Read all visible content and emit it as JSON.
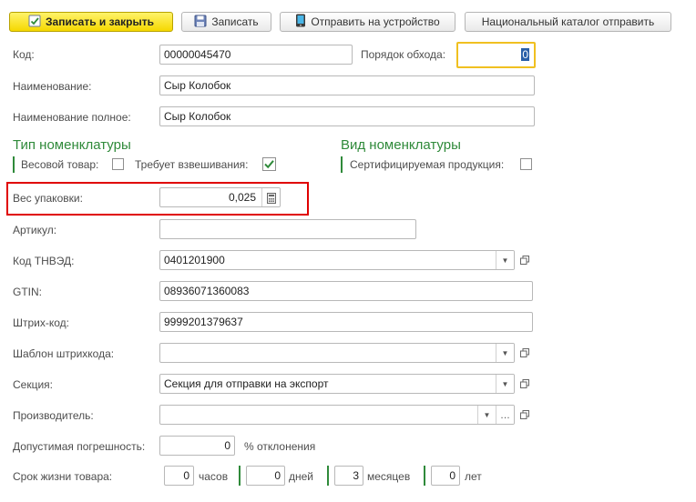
{
  "toolbar": {
    "save_close_label": "Записать и закрыть",
    "save_label": "Записать",
    "send_device_label": "Отправить на устройство",
    "national_catalog_label": "Национальный каталог отправить"
  },
  "form": {
    "code": {
      "label": "Код:",
      "value": "00000045470"
    },
    "order": {
      "label": "Порядок обхода:",
      "value": "0"
    },
    "name": {
      "label": "Наименование:",
      "value": "Сыр Колобок"
    },
    "full_name": {
      "label": "Наименование полное:",
      "value": "Сыр Колобок"
    },
    "type_section": {
      "title": "Тип номенклатуры",
      "weight_label": "Весовой товар:",
      "weight_checked": false,
      "weighing_label": "Требует взвешивания:",
      "weighing_checked": true
    },
    "kind_section": {
      "title": "Вид номенклатуры",
      "certified_label": "Сертифицируемая продукция:",
      "certified_checked": false
    },
    "pack_weight": {
      "label": "Вес упаковки:",
      "value": "0,025"
    },
    "article": {
      "label": "Артикул:",
      "value": ""
    },
    "tnved": {
      "label": "Код ТНВЭД:",
      "value": "0401201900"
    },
    "gtin": {
      "label": "GTIN:",
      "value": "08936071360083"
    },
    "barcode": {
      "label": "Штрих-код:",
      "value": "9999201379637"
    },
    "barcode_template": {
      "label": "Шаблон штрихкода:",
      "value": ""
    },
    "section": {
      "label": "Секция:",
      "value": "Секция для отправки на экспорт"
    },
    "manufacturer": {
      "label": "Производитель:",
      "value": ""
    },
    "tolerance": {
      "label": "Допустимая погрешность:",
      "value": "0",
      "suffix": "% отклонения"
    },
    "shelf_life": {
      "label": "Срок жизни товара:",
      "hours": {
        "value": "0",
        "unit": "часов"
      },
      "days": {
        "value": "0",
        "unit": "дней"
      },
      "months": {
        "value": "3",
        "unit": "месяцев"
      },
      "years": {
        "value": "0",
        "unit": "лет"
      }
    }
  },
  "colors": {
    "accent_green": "#2f8a3a",
    "highlight_red": "#e00000",
    "primary_yellow": "#f5d800"
  },
  "icons": {
    "save_close": "save-check-icon",
    "save": "floppy-icon",
    "send": "device-icon",
    "calculator": "calculator-icon",
    "dropdown": "chevron-down-icon",
    "open": "open-window-icon",
    "ellipsis": "ellipsis-icon"
  }
}
